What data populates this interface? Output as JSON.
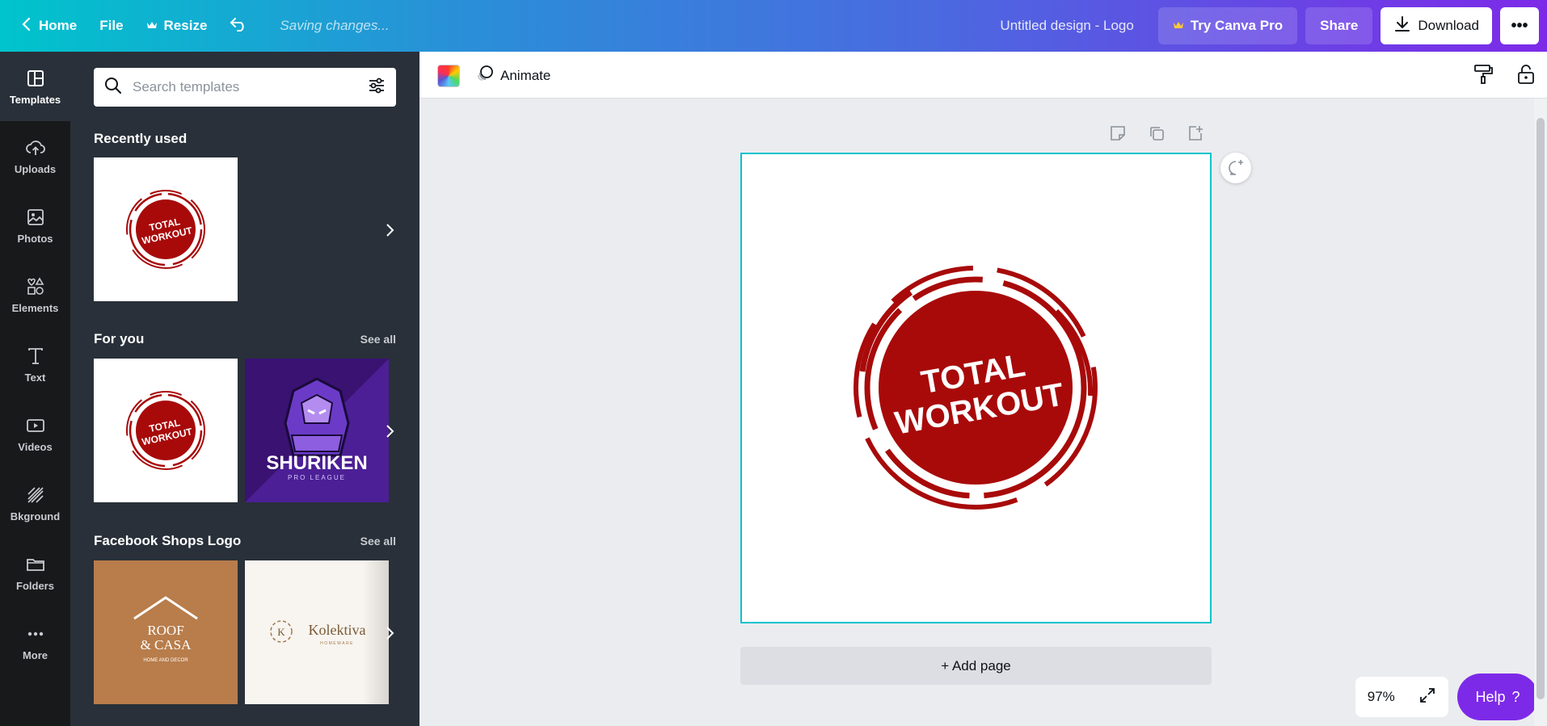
{
  "topbar": {
    "home": "Home",
    "file": "File",
    "resize": "Resize",
    "saving": "Saving changes...",
    "design_title": "Untitled design - Logo",
    "try_pro": "Try Canva Pro",
    "share": "Share",
    "download": "Download"
  },
  "nav": {
    "items": [
      {
        "label": "Templates",
        "icon": "templates-icon"
      },
      {
        "label": "Uploads",
        "icon": "upload-cloud-icon"
      },
      {
        "label": "Photos",
        "icon": "photos-icon"
      },
      {
        "label": "Elements",
        "icon": "elements-icon"
      },
      {
        "label": "Text",
        "icon": "text-icon"
      },
      {
        "label": "Videos",
        "icon": "videos-icon"
      },
      {
        "label": "Bkground",
        "icon": "background-icon"
      },
      {
        "label": "Folders",
        "icon": "folder-icon"
      },
      {
        "label": "More",
        "icon": "more-dots-icon"
      }
    ]
  },
  "panel": {
    "search_placeholder": "Search templates",
    "recently_used": "Recently used",
    "for_you": "For you",
    "facebook_shops": "Facebook Shops Logo",
    "see_all": "See all",
    "logo_line1": "TOTAL",
    "logo_line2": "WORKOUT",
    "shuriken_title": "SHURIKEN",
    "shuriken_sub": "PRO LEAGUE",
    "roof_line1": "ROOF",
    "roof_line2": "& CASA",
    "roof_sub": "HOME AND DECOR",
    "kolektiva_title": "Kolektiva",
    "kolektiva_sub": "HOMEWARE",
    "kolektiva_mark": "K"
  },
  "editor": {
    "animate": "Animate",
    "canvas_line1": "TOTAL",
    "canvas_line2": "WORKOUT",
    "add_page": "+ Add page",
    "zoom": "97%",
    "help": "Help",
    "help_mark": "?"
  },
  "colors": {
    "brand_red": "#a80a0a",
    "canva_purple": "#7d2ae8",
    "canva_teal": "#00c4cc"
  }
}
